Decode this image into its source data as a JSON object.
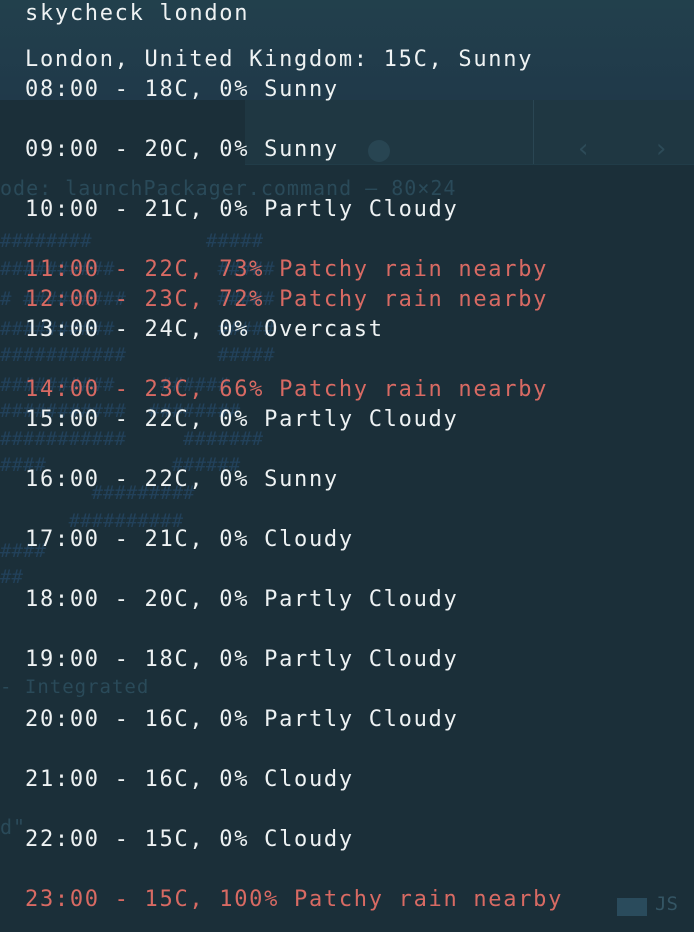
{
  "background": {
    "ghost_command": "ode: launchPackager.command — 80×24",
    "ghost_integrated": "- Integrated",
    "ghost_quote": "d\"",
    "ghost_tag": "JS",
    "toolbar_icons": [
      "chevron-left-icon",
      "chevron-right-icon"
    ]
  },
  "terminal": {
    "command": "skycheck london",
    "summary": "London, United Kingdom: 15C, Sunny",
    "forecast": [
      {
        "text": "08:00 - 18C, 0% Sunny",
        "rain": false
      },
      {
        "text": "09:00 - 20C, 0% Sunny",
        "rain": false
      },
      {
        "text": "10:00 - 21C, 0% Partly Cloudy",
        "rain": false
      },
      {
        "text": "11:00 - 22C, 73% Patchy rain nearby",
        "rain": true
      },
      {
        "text": "12:00 - 23C, 72% Patchy rain nearby",
        "rain": true
      },
      {
        "text": "13:00 - 24C, 0% Overcast",
        "rain": false
      },
      {
        "text": "14:00 - 23C, 66% Patchy rain nearby",
        "rain": true
      },
      {
        "text": "15:00 - 22C, 0% Partly Cloudy",
        "rain": false
      },
      {
        "text": "16:00 - 22C, 0% Sunny",
        "rain": false
      },
      {
        "text": "17:00 - 21C, 0% Cloudy",
        "rain": false
      },
      {
        "text": "18:00 - 20C, 0% Partly Cloudy",
        "rain": false
      },
      {
        "text": "19:00 - 18C, 0% Partly Cloudy",
        "rain": false
      },
      {
        "text": "20:00 - 16C, 0% Partly Cloudy",
        "rain": false
      },
      {
        "text": "21:00 - 16C, 0% Cloudy",
        "rain": false
      },
      {
        "text": "22:00 - 15C, 0% Cloudy",
        "rain": false
      },
      {
        "text": "23:00 - 15C, 100% Patchy rain nearby",
        "rain": true
      }
    ]
  },
  "colors": {
    "background": "#1d323c",
    "text": "#eef2f3",
    "rain_text": "#d86a63"
  }
}
